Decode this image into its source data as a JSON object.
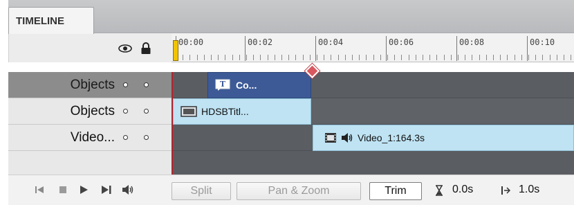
{
  "panel": {
    "tab_title": "TIMELINE"
  },
  "ruler": {
    "ticks": [
      "00:00",
      "00:02",
      "00:04",
      "00:06",
      "00:08",
      "00:10"
    ]
  },
  "tracks": [
    {
      "label": "Objects",
      "selected": true
    },
    {
      "label": "Objects",
      "selected": false
    },
    {
      "label": "Video...",
      "selected": false
    }
  ],
  "clips": {
    "caption": {
      "label": "Co...",
      "icon": "text-caption-icon"
    },
    "image": {
      "label": "HDSBTitl...",
      "icon": "image-icon"
    },
    "video": {
      "label": "Video_1:164.3s",
      "icon": "film-icon",
      "audio_icon": "speaker-icon"
    }
  },
  "playback": {
    "icons": [
      "rewind-to-start-icon",
      "stop-icon",
      "play-icon",
      "next-icon",
      "audio-icon"
    ]
  },
  "buttons": {
    "split": "Split",
    "pan_zoom": "Pan & Zoom",
    "trim": "Trim"
  },
  "readouts": {
    "duration": "0.0s",
    "start": "1.0s"
  },
  "colors": {
    "caption_clip": "#3d5a97",
    "media_clip": "#bfe3f3",
    "playhead": "#f2c400",
    "marker": "#d9575e",
    "track_bg": "#5a5d62"
  }
}
